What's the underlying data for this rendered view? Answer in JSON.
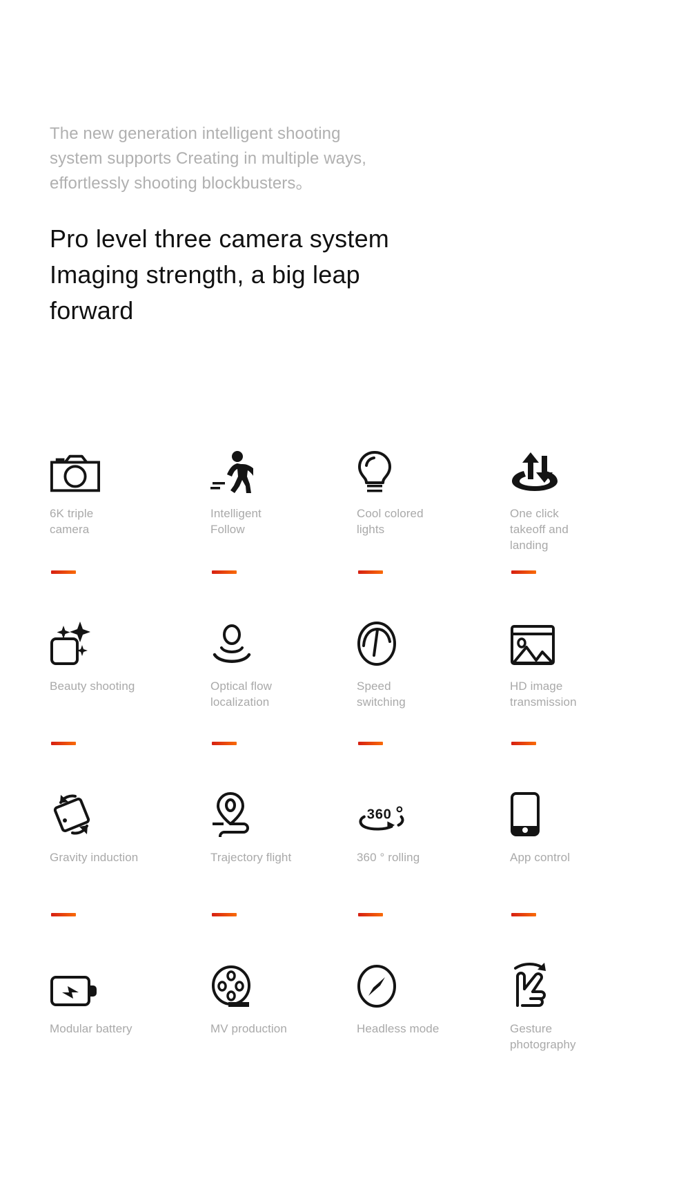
{
  "intro": {
    "text": "The new generation intelligent shooting\nsystem supports Creating in multiple ways,\neffortlessly shooting blockbusters。"
  },
  "headline": {
    "text": "Pro level three camera system\nImaging strength, a big leap\nforward"
  },
  "accent": {
    "dash_start": "#d61f12",
    "dash_end": "#f96b08",
    "label_color": "#a9a9a9",
    "intro_color": "#b0b0b0",
    "headline_color": "#111111"
  },
  "features": [
    {
      "icon": "camera-icon",
      "label": "6K triple\ncamera",
      "dash": true
    },
    {
      "icon": "walking-person-icon",
      "label": "Intelligent\nFollow",
      "dash": true
    },
    {
      "icon": "light-bulb-icon",
      "label": "Cool colored\nlights",
      "dash": true
    },
    {
      "icon": "takeoff-landing-icon",
      "label": "One click\ntakeoff and\nlanding",
      "dash": true
    },
    {
      "icon": "sparkle-beauty-icon",
      "label": "Beauty shooting",
      "dash": true
    },
    {
      "icon": "optical-flow-icon",
      "label": "Optical flow\nlocalization",
      "dash": true
    },
    {
      "icon": "speedometer-icon",
      "label": "Speed\nswitching",
      "dash": true
    },
    {
      "icon": "hd-image-icon",
      "label": "HD image\ntransmission",
      "dash": true
    },
    {
      "icon": "gravity-rotate-icon",
      "label": "Gravity induction",
      "dash": true
    },
    {
      "icon": "trajectory-pin-icon",
      "label": "Trajectory flight",
      "dash": true
    },
    {
      "icon": "360-rolling-icon",
      "label": "360 ° rolling",
      "dash": true
    },
    {
      "icon": "phone-app-icon",
      "label": "App control",
      "dash": true
    },
    {
      "icon": "battery-bolt-icon",
      "label": "Modular battery",
      "dash": false
    },
    {
      "icon": "film-reel-icon",
      "label": "MV production",
      "dash": false
    },
    {
      "icon": "compass-icon",
      "label": "Headless mode",
      "dash": false
    },
    {
      "icon": "gesture-hand-icon",
      "label": "Gesture\nphotography",
      "dash": false
    }
  ]
}
